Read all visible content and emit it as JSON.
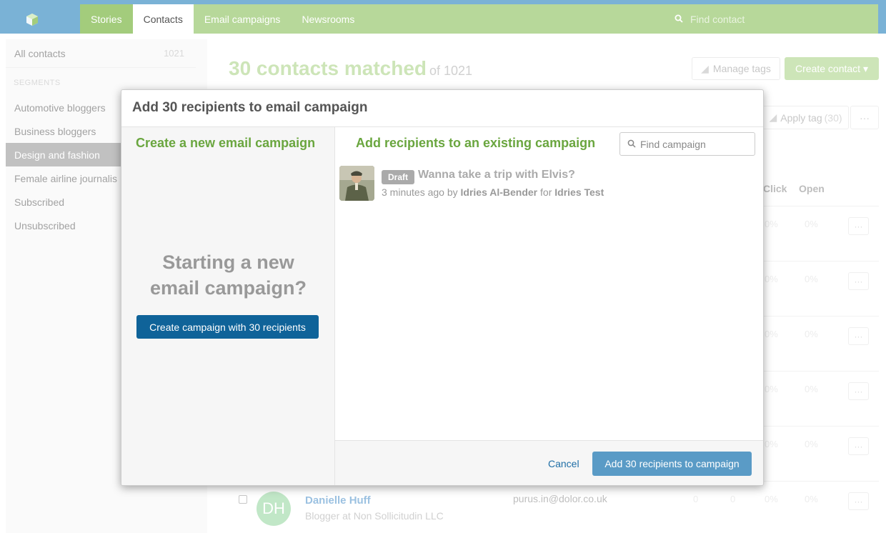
{
  "nav": {
    "tabs": [
      {
        "label": "Stories"
      },
      {
        "label": "Contacts"
      },
      {
        "label": "Email campaigns"
      },
      {
        "label": "Newsrooms"
      }
    ],
    "search_placeholder": "Find contact"
  },
  "sidebar": {
    "all_contacts": {
      "label": "All contacts",
      "count": "1021"
    },
    "segments_heading": "SEGMENTS",
    "segments": [
      {
        "label": "Automotive bloggers"
      },
      {
        "label": "Business bloggers"
      },
      {
        "label": "Design and fashion"
      },
      {
        "label": "Female airline journalis"
      },
      {
        "label": "Subscribed"
      },
      {
        "label": "Unsubscribed"
      }
    ]
  },
  "main": {
    "title": "30 contacts matched",
    "title_of": "of 1021",
    "manage_tags": "Manage tags",
    "create_contact": "Create contact ▾",
    "apply_tag": "Apply tag",
    "apply_tag_count": "(30)",
    "more": "···",
    "col_click": "Click",
    "col_open": "Open",
    "row_pct": "0%",
    "contact": {
      "initials": "DH",
      "name": "Danielle Huff",
      "subtitle": "Blogger at Non Sollicitudin LLC",
      "email": "purus.in@dolor.co.uk",
      "zero": "0"
    }
  },
  "modal": {
    "title": "Add 30 recipients to email campaign",
    "left_heading": "Create a new email campaign",
    "starting_line1": "Starting a new",
    "starting_line2": "email campaign?",
    "create_button": "Create campaign with 30 recipients",
    "right_heading": "Add recipients to an existing campaign",
    "find_placeholder": "Find campaign",
    "campaign": {
      "badge": "Draft",
      "title": "Wanna take a trip with Elvis?",
      "time": "3 minutes ago by",
      "author": "Idries Al-Bender",
      "for": "for",
      "target": "Idries Test"
    },
    "cancel": "Cancel",
    "add_button": "Add 30 recipients to campaign"
  },
  "colors": {
    "nav_green": "#b7d89a",
    "nav_blue": "#7ab2d6",
    "accent_green": "#6aa63f",
    "primary_blue": "#0f6399"
  }
}
